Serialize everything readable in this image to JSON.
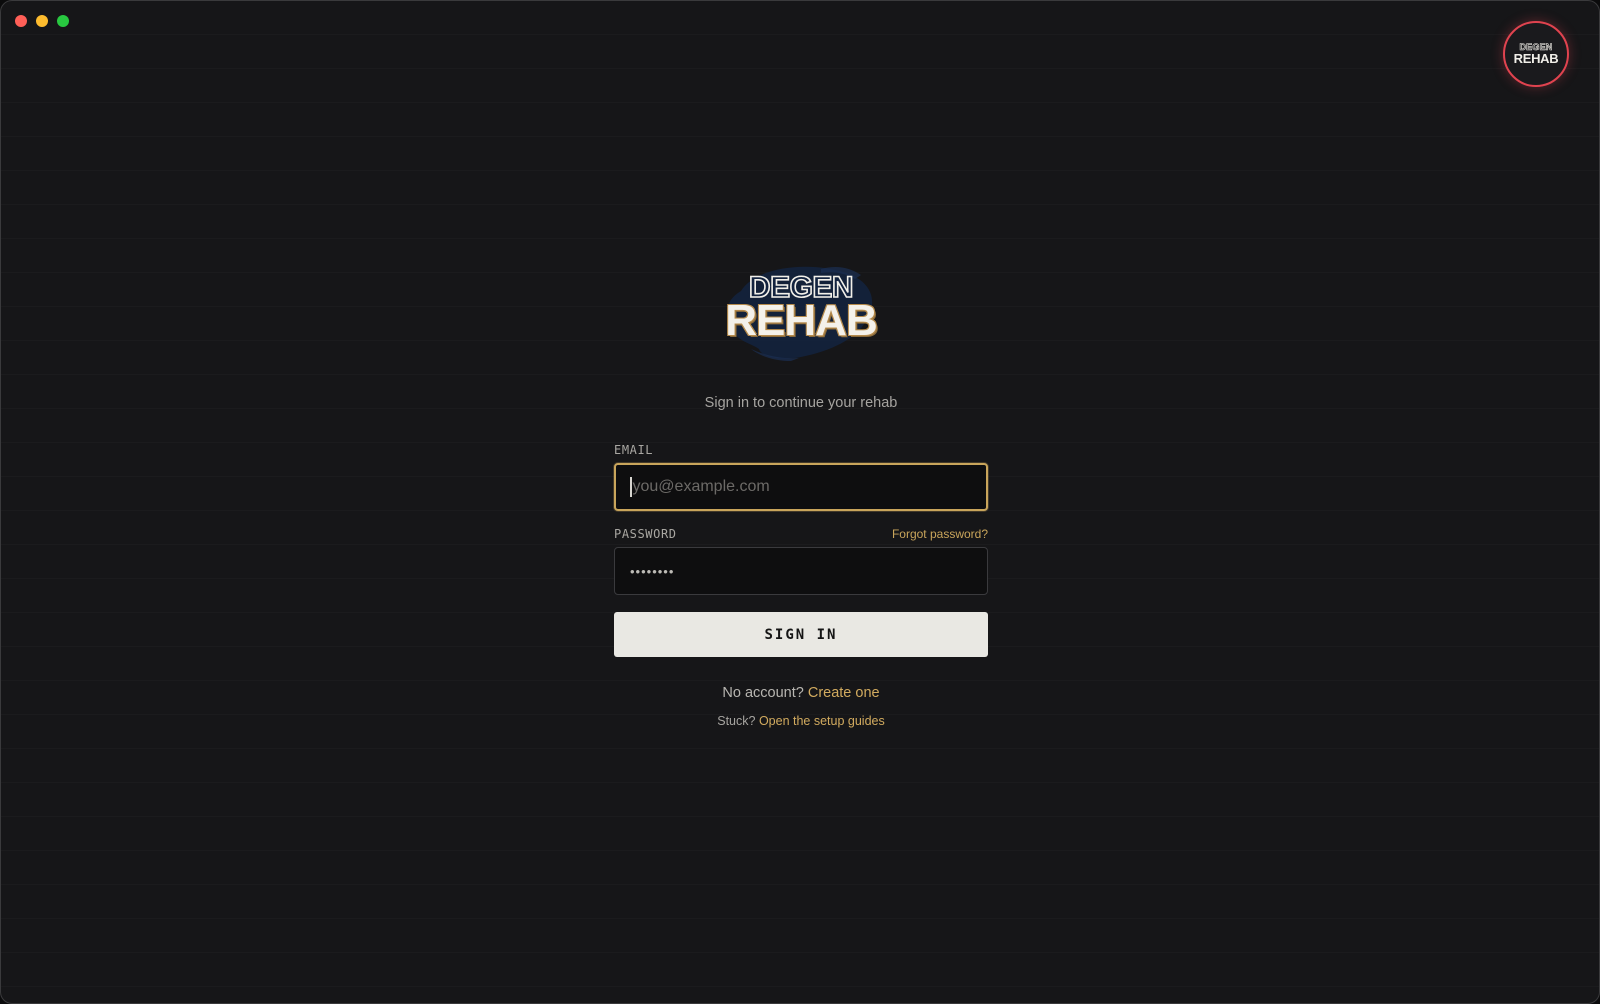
{
  "window": {
    "controls": [
      "close",
      "minimize",
      "maximize"
    ]
  },
  "brand": {
    "logo_line1": "DEGEN",
    "logo_line2": "REHAB",
    "badge_line1": "DEGEN",
    "badge_line2": "REHAB",
    "badge_ring_color": "#e0434f",
    "accent_color": "#c9a55b"
  },
  "login": {
    "subtitle": "Sign in to continue your rehab",
    "email_label": "EMAIL",
    "email_placeholder": "you@example.com",
    "email_value": "",
    "password_label": "PASSWORD",
    "password_mask": "••••••••",
    "forgot_label": "Forgot password?",
    "submit_label": "SIGN IN",
    "no_account_text": "No account?",
    "create_link": "Create one",
    "stuck_text": "Stuck?",
    "guides_link": "Open the setup guides"
  }
}
